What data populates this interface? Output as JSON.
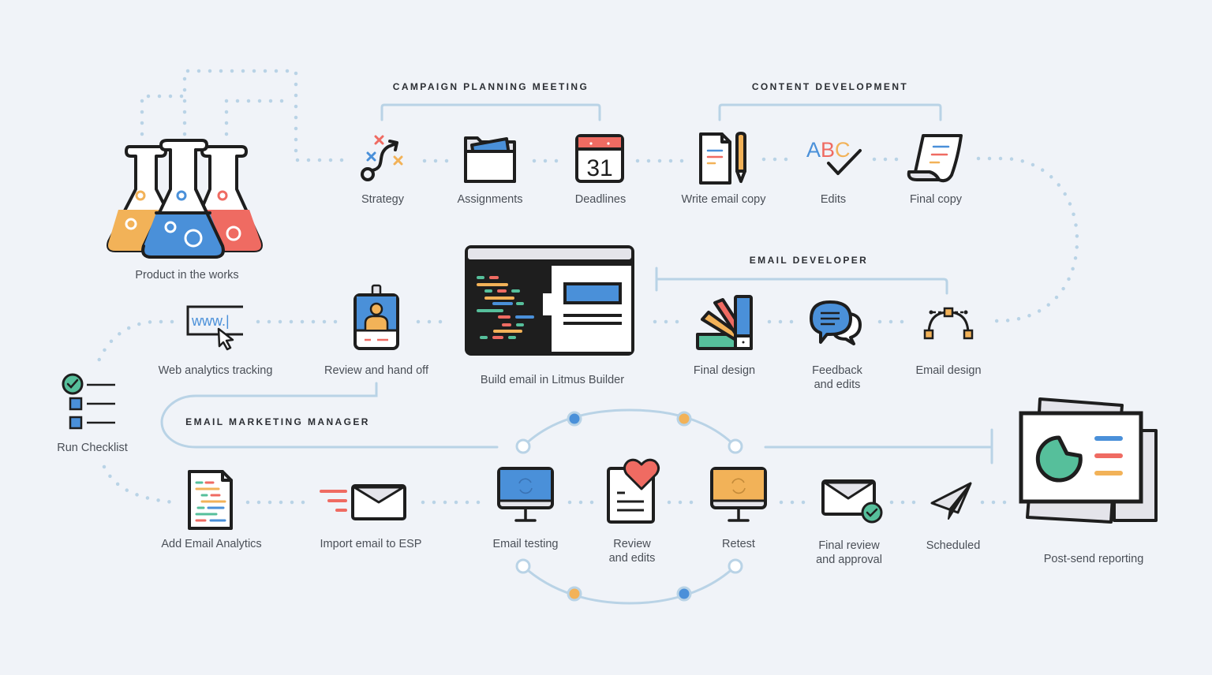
{
  "colors": {
    "background": "#f0f3f8",
    "connector": "#b9d3e6",
    "stroke": "#1e1e1e",
    "blue": "#4a90d9",
    "red": "#ef6b62",
    "orange": "#f2b258",
    "green": "#56bf9b",
    "label": "#4a4f57",
    "section": "#2b2e33"
  },
  "sections": {
    "campaign_planning": "CAMPAIGN PLANNING MEETING",
    "content_development": "CONTENT DEVELOPMENT",
    "email_developer": "EMAIL DEVELOPER",
    "email_marketing_manager": "EMAIL MARKETING MANAGER"
  },
  "steps": {
    "product": "Product in the works",
    "strategy": "Strategy",
    "assignments": "Assignments",
    "deadlines": "Deadlines",
    "calendar_day": "31",
    "write_copy": "Write email copy",
    "edits": "Edits",
    "edits_glyph": "ABC",
    "final_copy": "Final copy",
    "email_design": "Email design",
    "feedback_line1": "Feedback",
    "feedback_line2": "and edits",
    "final_design": "Final design",
    "build_email": "Build email in Litmus Builder",
    "review_handoff": "Review and hand off",
    "web_analytics": "Web analytics tracking",
    "www_glyph": "www.|",
    "run_checklist": "Run Checklist",
    "add_analytics": "Add Email Analytics",
    "import_esp": "Import email to ESP",
    "email_testing": "Email testing",
    "review_edits_line1": "Review",
    "review_edits_line2": "and edits",
    "retest": "Retest",
    "final_review_line1": "Final review",
    "final_review_line2": "and approval",
    "scheduled": "Scheduled",
    "post_send": "Post-send reporting"
  }
}
